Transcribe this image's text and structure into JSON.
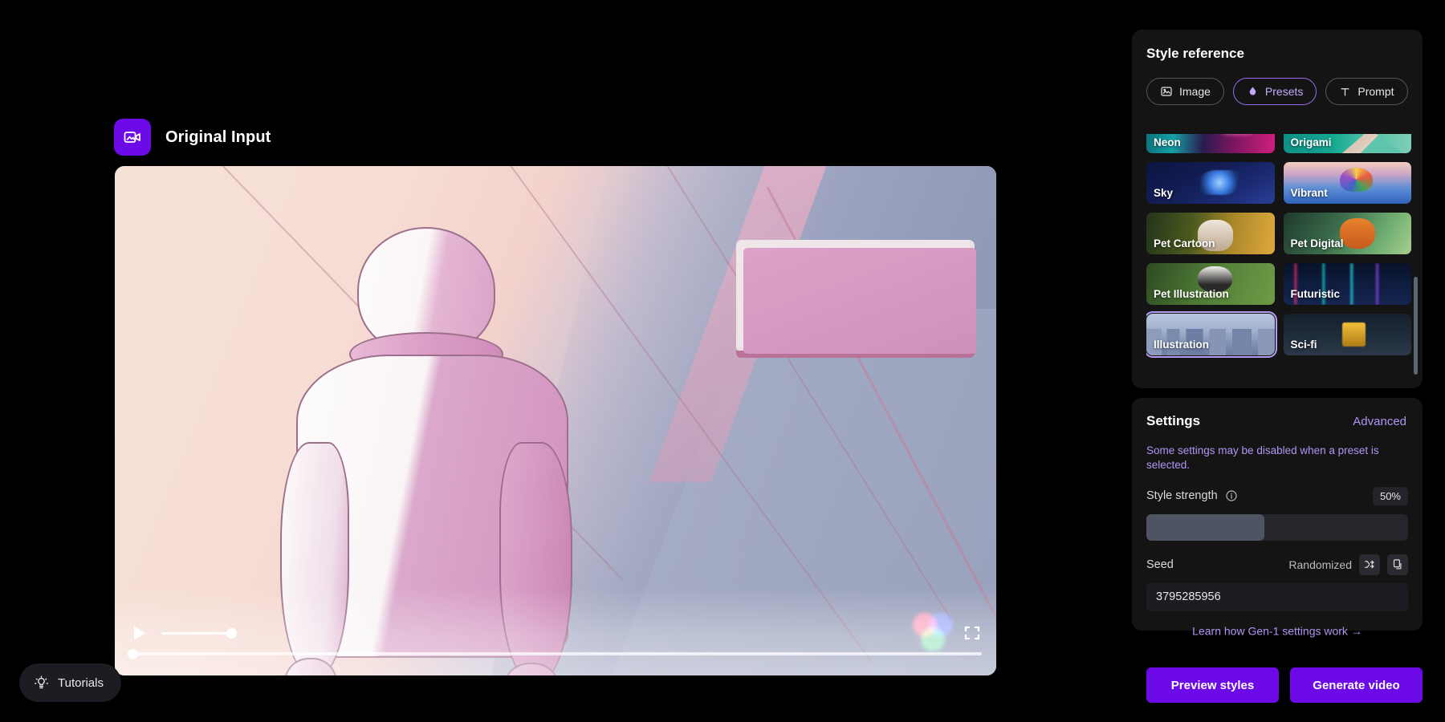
{
  "stage": {
    "input_header": {
      "icon": "video-image-icon",
      "title": "Original Input"
    },
    "player": {
      "play_icon": "play-icon",
      "volume_level": 100,
      "progress": 0,
      "color_icon": "color-wheel-icon",
      "expand_icon": "fullscreen-icon"
    },
    "tutorials": {
      "icon": "lightbulb-icon",
      "label": "Tutorials"
    }
  },
  "style_reference": {
    "title": "Style reference",
    "tabs": [
      {
        "label": "Image",
        "icon": "image-icon",
        "active": false
      },
      {
        "label": "Presets",
        "icon": "droplet-icon",
        "active": true
      },
      {
        "label": "Prompt",
        "icon": "text-t-icon",
        "active": false
      }
    ],
    "presets": [
      {
        "label": "Neon",
        "art": "art-neon",
        "selected": false
      },
      {
        "label": "Origami",
        "art": "art-origami",
        "selected": false
      },
      {
        "label": "Sky",
        "art": "art-sky",
        "selected": false
      },
      {
        "label": "Vibrant",
        "art": "art-vibrant",
        "selected": false
      },
      {
        "label": "Pet Cartoon",
        "art": "art-petcartoon",
        "selected": false
      },
      {
        "label": "Pet Digital",
        "art": "art-petdigital",
        "selected": false
      },
      {
        "label": "Pet Illustration",
        "art": "art-petillus",
        "selected": false
      },
      {
        "label": "Futuristic",
        "art": "art-futuristic",
        "selected": false
      },
      {
        "label": "Illustration",
        "art": "art-illustration",
        "selected": true
      },
      {
        "label": "Sci-fi",
        "art": "art-scifi",
        "selected": false
      }
    ]
  },
  "settings": {
    "title": "Settings",
    "advanced_label": "Advanced",
    "notice": "Some settings may be disabled when a preset is selected.",
    "style_strength": {
      "label": "Style strength",
      "info_icon": "info-icon",
      "value_label": "50%",
      "value": 50
    },
    "seed": {
      "label": "Seed",
      "mode_label": "Randomized",
      "shuffle_icon": "shuffle-icon",
      "copy_icon": "copy-icon",
      "value": "3795285956"
    },
    "learn_link": {
      "label": "Learn how Gen-1 settings work",
      "arrow": "→"
    }
  },
  "actions": {
    "preview_label": "Preview styles",
    "generate_label": "Generate video"
  },
  "colors": {
    "accent_purple": "#6d0ae8",
    "link_purple": "#b195f5",
    "panel_bg": "#141414",
    "page_bg": "#000000"
  }
}
